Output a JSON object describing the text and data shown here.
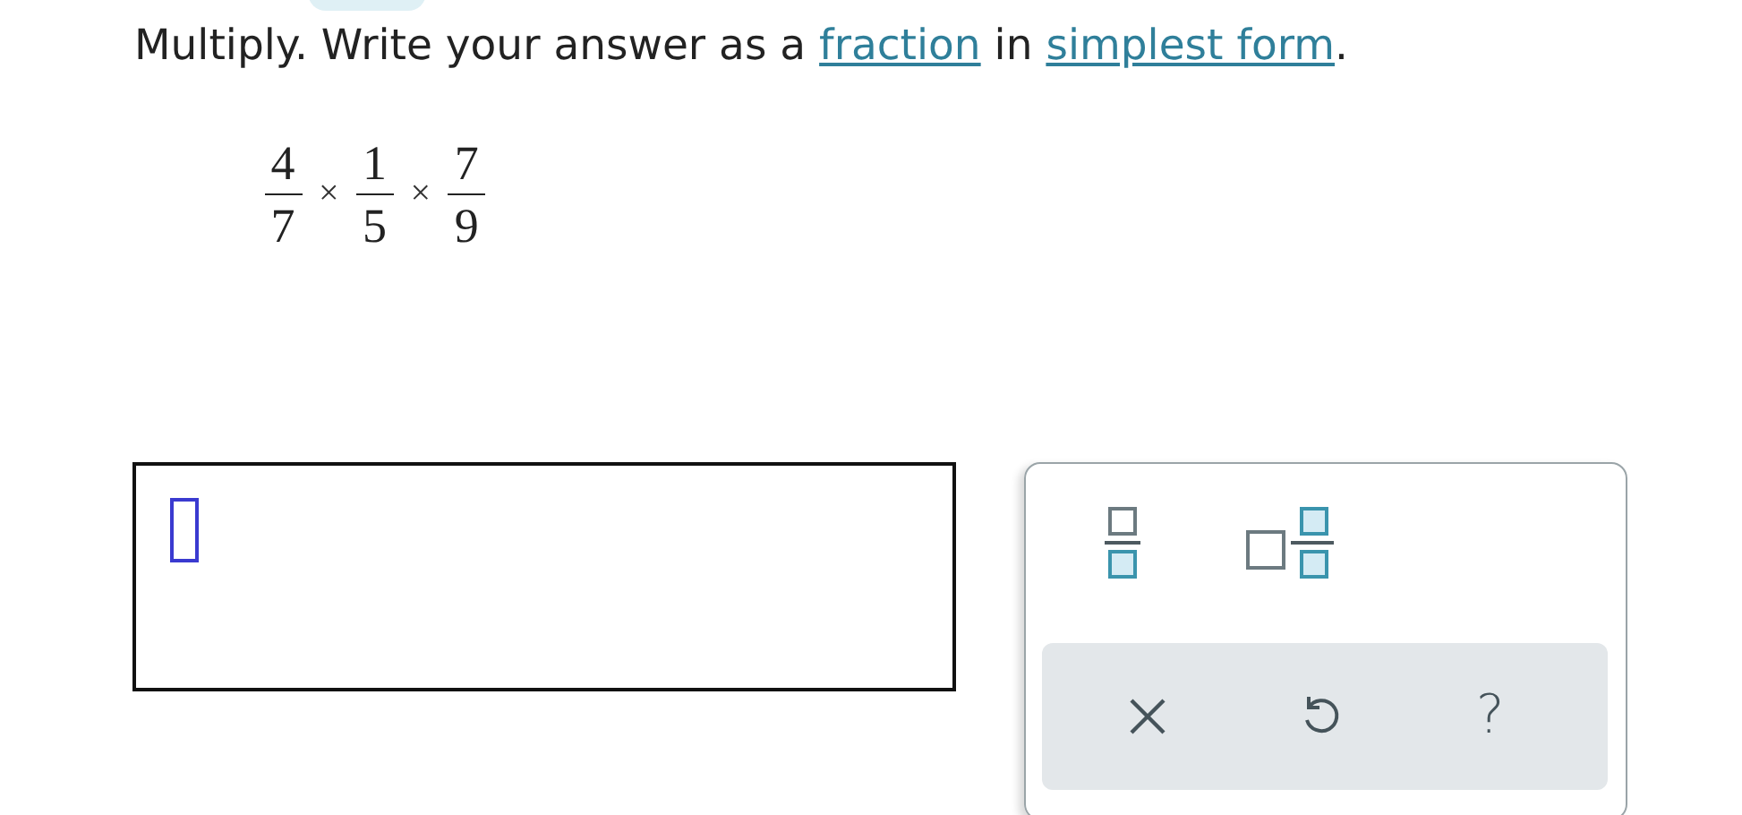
{
  "instruction": [
    {
      "kind": "text",
      "text": "Multiply. Write your answer as a "
    },
    {
      "kind": "link",
      "text": "fraction"
    },
    {
      "kind": "text",
      "text": " in "
    },
    {
      "kind": "link",
      "text": "simplest form"
    },
    {
      "kind": "text",
      "text": "."
    }
  ],
  "expression": [
    {
      "kind": "fraction",
      "numerator": "4",
      "denominator": "7"
    },
    {
      "kind": "operator",
      "text": "×"
    },
    {
      "kind": "fraction",
      "numerator": "1",
      "denominator": "5"
    },
    {
      "kind": "operator",
      "text": "×"
    },
    {
      "kind": "fraction",
      "numerator": "7",
      "denominator": "9"
    }
  ],
  "answer": {
    "kind": "empty-slot"
  },
  "keypad": {
    "templates": [
      {
        "kind": "fraction"
      },
      {
        "kind": "mixed-number"
      }
    ],
    "actions": [
      {
        "kind": "clear"
      },
      {
        "kind": "undo"
      },
      {
        "kind": "help",
        "text": "?"
      }
    ]
  }
}
